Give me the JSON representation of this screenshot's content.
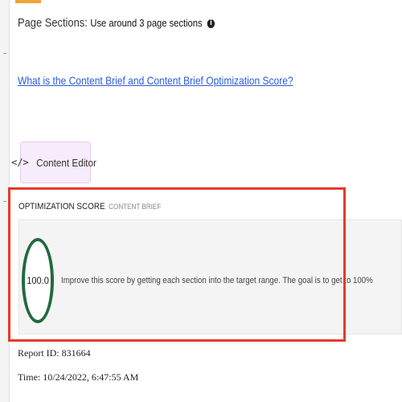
{
  "page_sections": {
    "label": "Page Sections:",
    "value": "Use around 3 page sections",
    "info_icon": "info-icon"
  },
  "help_link": "What is the Content Brief and Content Brief Optimization Score?",
  "content_editor": {
    "icon_glyph": "</>",
    "icon": "code-icon",
    "label": "Content Editor"
  },
  "optimization": {
    "title": "OPTIMIZATION SCORE",
    "subtitle": "CONTENT BRIEF",
    "score": "100.0",
    "description": "Improve this score by getting each section into the target range. The goal is to get to 100%",
    "ring_color": "#24693d",
    "highlight_color": "#e33a2d"
  },
  "report": {
    "id_line": "Report ID: 831664",
    "time_line": "Time: 10/24/2022, 6:47:55 AM"
  },
  "colors": {
    "link": "#2a5bd7",
    "editor_bg": "#f7ecfb",
    "top_accent": "#f2a33a"
  }
}
